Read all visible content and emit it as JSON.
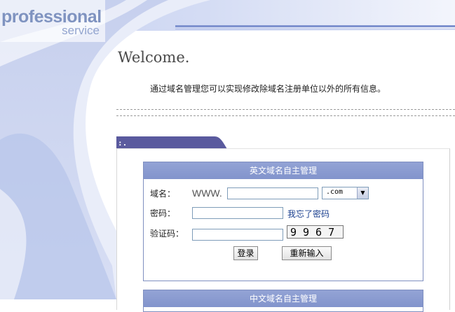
{
  "brand": {
    "name": "professional",
    "tagline": "service"
  },
  "welcome": {
    "title": "Welcome.",
    "intro": "通过域名管理您可以实现修改除域名注册单位以外的所有信息。"
  },
  "panel": {
    "tab_label": ":."
  },
  "english_domain": {
    "header": "英文域名自主管理",
    "domain_label": "域名：",
    "www_prefix": "WWW.",
    "domain_value": "",
    "tld_selected": ".com",
    "password_label": "密码：",
    "password_value": "",
    "forgot_link": "我忘了密码",
    "captcha_label": "验证码：",
    "captcha_value": "",
    "captcha_text": "9967",
    "login_button": "登录",
    "reset_button": "重新输入"
  },
  "chinese_domain": {
    "header": "中文域名自主管理"
  },
  "colors": {
    "accent": "#8294cc",
    "link": "#1a3f8f",
    "tab": "#5a5a9e"
  }
}
